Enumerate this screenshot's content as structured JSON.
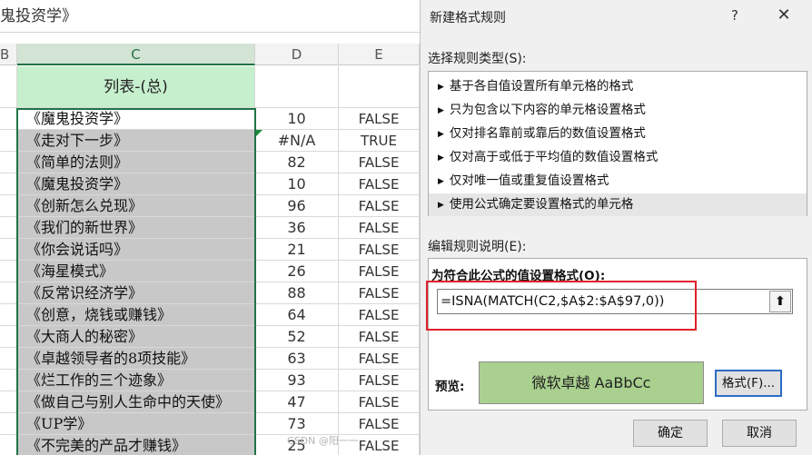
{
  "sheet": {
    "formula_bar_text": "鬼投资学》",
    "columns": [
      "B",
      "C",
      "D",
      "E"
    ],
    "header_cell": "列表-(总)",
    "rows": [
      {
        "c": "《魔鬼投资学》",
        "d": "10",
        "e": "FALSE"
      },
      {
        "c": "《走对下一步》",
        "d": "#N/A",
        "e": "TRUE"
      },
      {
        "c": "《简单的法则》",
        "d": "82",
        "e": "FALSE"
      },
      {
        "c": "《魔鬼投资学》",
        "d": "10",
        "e": "FALSE"
      },
      {
        "c": "《创新怎么兑现》",
        "d": "96",
        "e": "FALSE"
      },
      {
        "c": "《我们的新世界》",
        "d": "36",
        "e": "FALSE"
      },
      {
        "c": "《你会说话吗》",
        "d": "21",
        "e": "FALSE"
      },
      {
        "c": "《海星模式》",
        "d": "26",
        "e": "FALSE"
      },
      {
        "c": "《反常识经济学》",
        "d": "88",
        "e": "FALSE"
      },
      {
        "c": "《创意，烧钱或赚钱》",
        "d": "64",
        "e": "FALSE"
      },
      {
        "c": "《大商人的秘密》",
        "d": "52",
        "e": "FALSE"
      },
      {
        "c": "《卓越领导者的8项技能》",
        "d": "63",
        "e": "FALSE"
      },
      {
        "c": "《烂工作的三个迹象》",
        "d": "93",
        "e": "FALSE"
      },
      {
        "c": "《做自己与别人生命中的天使》",
        "d": "47",
        "e": "FALSE"
      },
      {
        "c": "《UP学》",
        "d": "73",
        "e": "FALSE"
      },
      {
        "c": "《不完美的产品才赚钱》",
        "d": "25",
        "e": "FALSE"
      }
    ]
  },
  "dialog": {
    "title": "新建格式规则",
    "help": "?",
    "close": "✕",
    "rule_type_label": "选择规则类型(S):",
    "rule_types": [
      "基于各自值设置所有单元格的格式",
      "只为包含以下内容的单元格设置格式",
      "仅对排名靠前或靠后的数值设置格式",
      "仅对高于或低于平均值的数值设置格式",
      "仅对唯一值或重复值设置格式",
      "使用公式确定要设置格式的单元格"
    ],
    "selected_rule_index": 5,
    "rule_arrow": "▶",
    "edit_desc_label": "编辑规则说明(E):",
    "condition_label": "为符合此公式的值设置格式(O):",
    "formula": "=ISNA(MATCH(C2,$A$2:$A$97,0))",
    "collapse_icon": "⬆",
    "preview_label": "预览:",
    "preview_text": "微软卓越  AaBbCc",
    "preview_fill": "#a9d08e",
    "format_button": "格式(F)...",
    "ok_button": "确定",
    "cancel_button": "取消"
  },
  "watermark": "CSDN @阳一一",
  "colors": {
    "accent_green": "#217346",
    "highlight_red": "#e0202a",
    "header_fill": "#c6efce",
    "selection_fill": "#c8c8c8"
  }
}
